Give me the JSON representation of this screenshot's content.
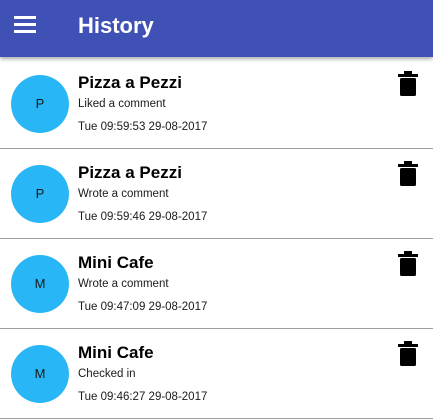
{
  "appbar": {
    "title": "History",
    "menu_icon": "menu-icon",
    "background": "#3f51b5"
  },
  "avatar_color": "#29b6f6",
  "delete_icon": "trash-icon",
  "entries": [
    {
      "initial": "P",
      "name": "Pizza a Pezzi",
      "action": "Liked a comment",
      "time": "Tue 09:59:53 29-08-2017"
    },
    {
      "initial": "P",
      "name": "Pizza a Pezzi",
      "action": "Wrote a comment",
      "time": "Tue 09:59:46 29-08-2017"
    },
    {
      "initial": "M",
      "name": "Mini Cafe",
      "action": "Wrote a comment",
      "time": "Tue 09:47:09 29-08-2017"
    },
    {
      "initial": "M",
      "name": "Mini Cafe",
      "action": "Checked in",
      "time": "Tue 09:46:27 29-08-2017"
    }
  ]
}
